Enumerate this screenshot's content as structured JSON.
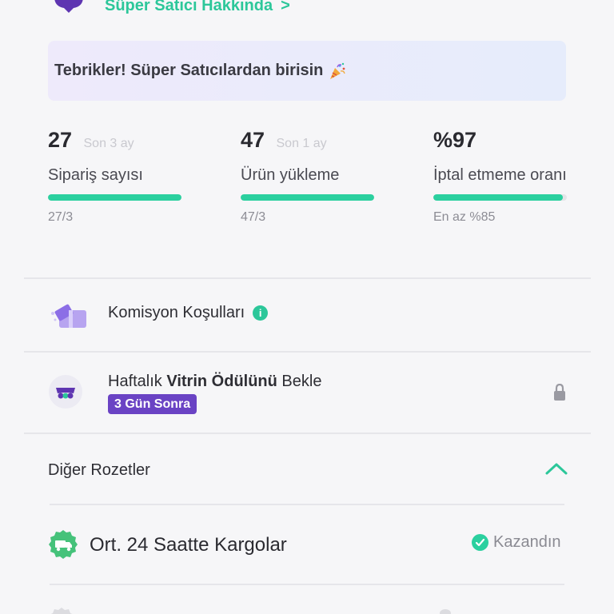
{
  "header": {
    "link_label": "Süper Satıcı Hakkında",
    "link_chevron": ">"
  },
  "banner": {
    "text": "Tebrikler! Süper Satıcılardan birisin",
    "icon": "party-popper-icon"
  },
  "stats": [
    {
      "value": "27",
      "period": "Son 3 ay",
      "label": "Sipariş sayısı",
      "sub": "27/3",
      "progress": 1.0
    },
    {
      "value": "47",
      "period": "Son 1 ay",
      "label": "Ürün yükleme",
      "sub": "47/3",
      "progress": 1.0
    },
    {
      "value": "%97",
      "period": "",
      "label": "İptal etmeme oranı",
      "sub": "En az %85",
      "progress": 0.97
    }
  ],
  "komisyon": {
    "label": "Komisyon Koşulları",
    "info_glyph": "i"
  },
  "vitrin": {
    "prefix": "Haftalık ",
    "bold": "Vitrin Ödülünü",
    "suffix": " Bekle",
    "pill": "3 Gün Sonra"
  },
  "diger": {
    "label": "Diğer Rozetler"
  },
  "badges": [
    {
      "label": "Ort. 24 Saatte Kargolar",
      "status": "Kazandın"
    }
  ],
  "colors": {
    "accent": "#2cc79a",
    "purple": "#6a43c4",
    "progress": "#2bd09f",
    "banner_start": "#eeeafb",
    "banner_end": "#e6ecfb"
  }
}
